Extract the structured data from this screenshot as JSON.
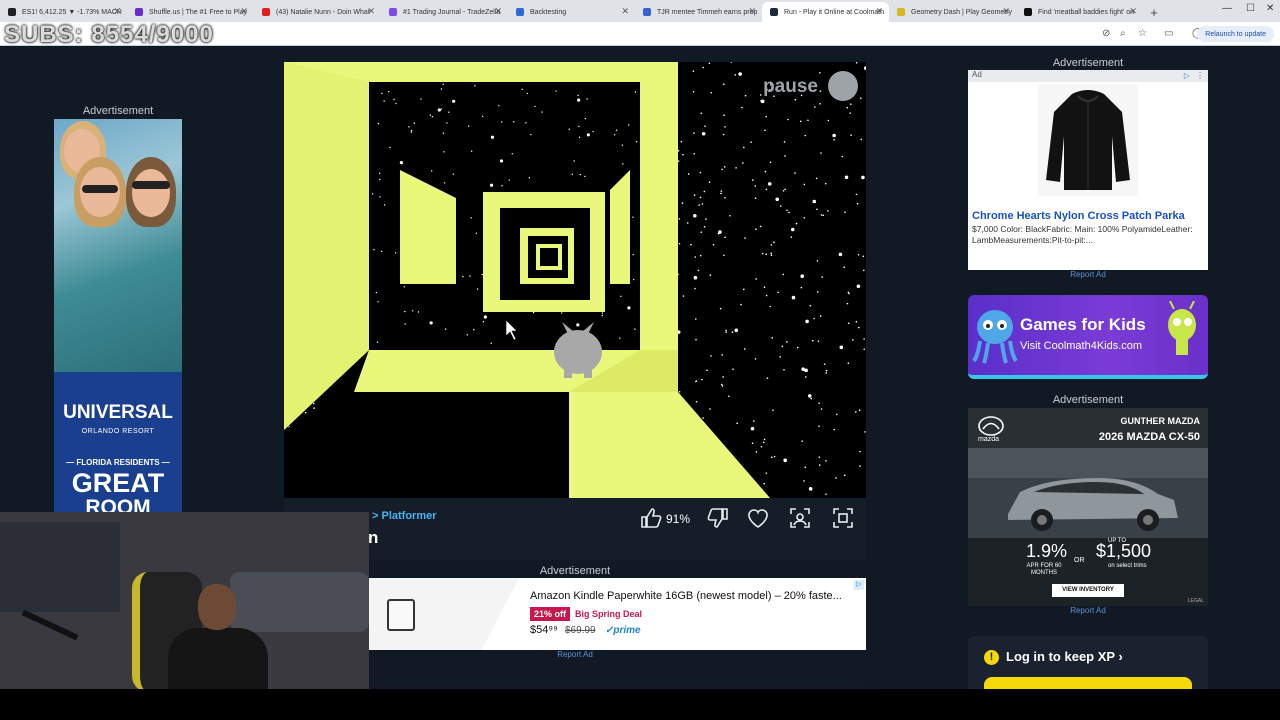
{
  "browser": {
    "tabs": [
      {
        "label": "ES1! 6,412.25 ▼ -1.73% MACR",
        "favicon_color": "#1e2226"
      },
      {
        "label": "Shuffle.us | The #1 Free to Play",
        "favicon_color": "#6a2ad1"
      },
      {
        "label": "(43) Natalie Nunn - Doin What",
        "favicon_color": "#e02020"
      },
      {
        "label": "#1 Trading Journal - TradeZella",
        "favicon_color": "#7b4ce6"
      },
      {
        "label": "Backtesting",
        "favicon_color": "#2d6bd6"
      },
      {
        "label": "TJR mentee Timmeh earns prop",
        "favicon_color": "#3b5fd0"
      },
      {
        "label": "Run - Play it Online at Coolmath",
        "favicon_color": "#1e2a3a"
      },
      {
        "label": "Geometry Dash | Play Geometry",
        "favicon_color": "#d8b720"
      },
      {
        "label": "Find 'meatball baddies fight' on",
        "favicon_color": "#111111"
      }
    ],
    "active_tab": 6,
    "new_tab": "+",
    "relaunch": "Relaunch to update"
  },
  "overlay": {
    "subs": "SUBS: 8554/9000"
  },
  "ads": {
    "label": "Advertisement",
    "report": "Report Ad",
    "left": {
      "brand": "UNIVERSAL",
      "brand_sub": "ORLANDO RESORT",
      "florida": "— FLORIDA RESIDENTS —",
      "great": "GREAT",
      "room": "ROOM RATES"
    },
    "parka": {
      "ad_tag": "Ad",
      "title": "Chrome Hearts Nylon Cross Patch Parka",
      "desc": "$7,000 Color: BlackFabric: Main: 100% PolyamideLeather: LambMeasurements:Pit-to-pit:..."
    },
    "games_kids": {
      "title": "Games for Kids",
      "sub": "Visit Coolmath4Kids.com"
    },
    "mazda": {
      "dealer": "GUNTHER MAZDA",
      "model": "2026 MAZDA CX-50",
      "brand": "mazda",
      "rate": "1.9%",
      "apr": "APR FOR 60 MONTHS",
      "or": "OR",
      "upto": "UP TO",
      "cash": "$1,500",
      "trims": "on select trims",
      "button": "VIEW INVENTORY",
      "legal": "LEGAL"
    },
    "kindle": {
      "title": "Amazon Kindle Paperwhite 16GB (newest model) – 20% faste...",
      "badge": "21% off",
      "deal": "Big Spring Deal",
      "price": "$54⁹⁹",
      "old_price": "$69.99",
      "prime": "✓prime"
    }
  },
  "game": {
    "pause_label": "pause",
    "breadcrumb": "> Platformer",
    "title": "n",
    "rating": "91%"
  },
  "xp": {
    "text": "Log in to keep XP ›",
    "icon": "!"
  },
  "colors": {
    "tunnel": "#e9f77a",
    "space": "#000000",
    "page_bg": "#111a24"
  }
}
